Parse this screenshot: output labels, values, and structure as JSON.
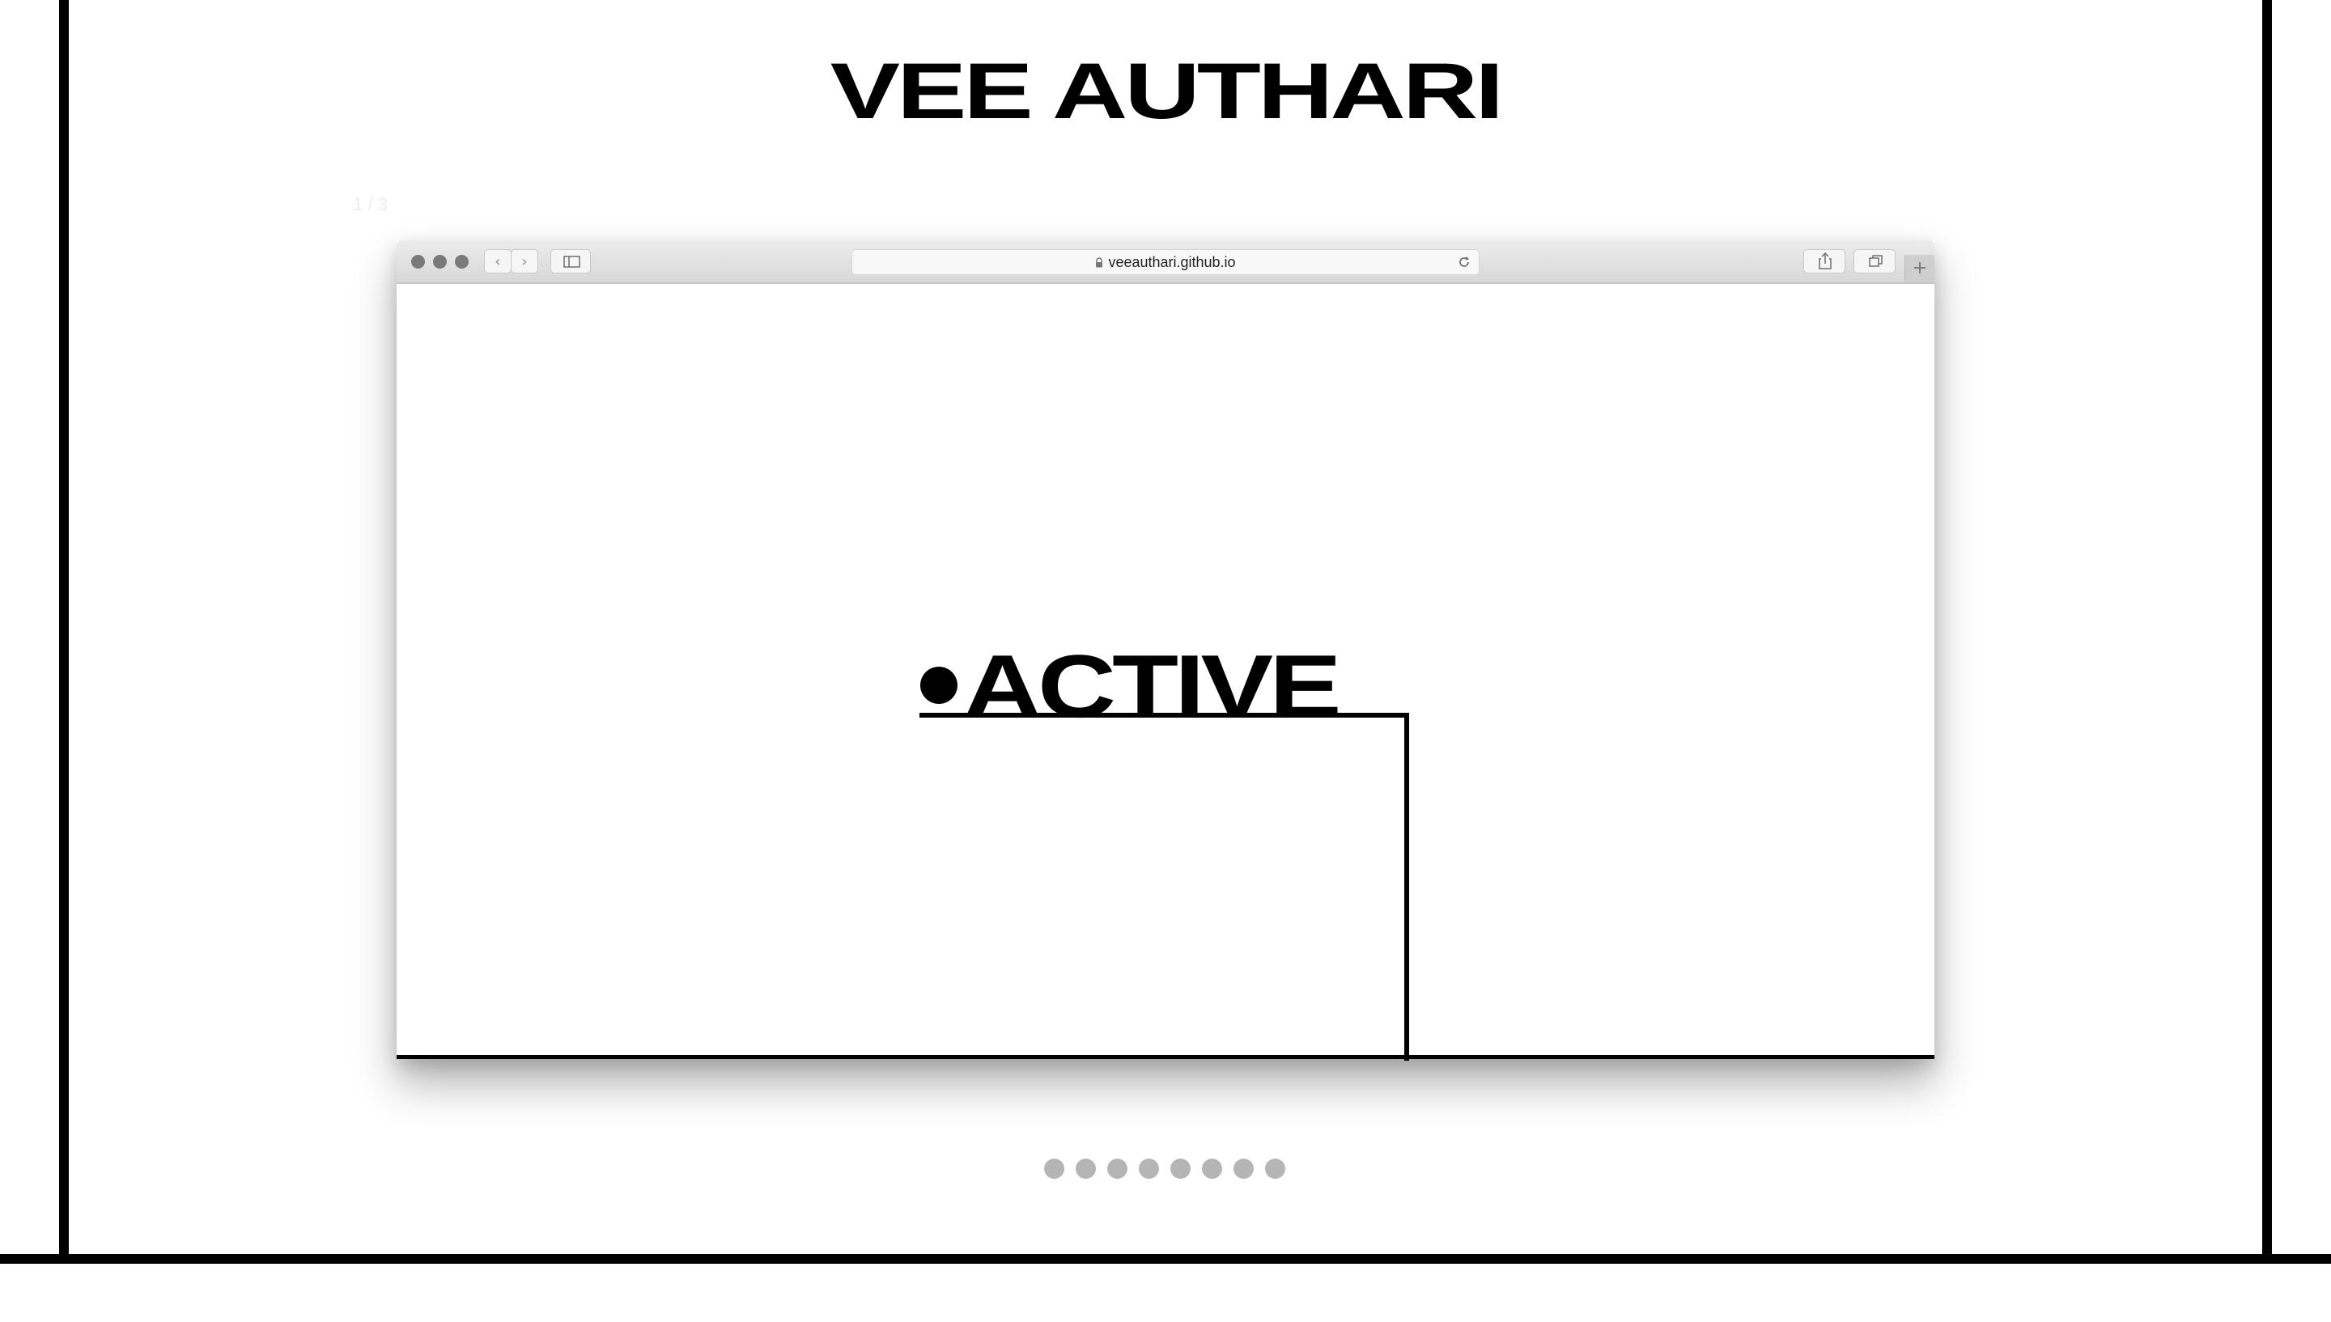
{
  "site": {
    "title": "VEE AUTHARI"
  },
  "slideshow": {
    "counter": "1 / 3",
    "dots": [
      1,
      2,
      3,
      4,
      5,
      6,
      7,
      8
    ]
  },
  "browser": {
    "address": "veeauthari.github.io",
    "window_controls": [
      "close-icon",
      "minimize-icon",
      "zoom-icon"
    ],
    "toolbar_icons": [
      "back-icon",
      "forward-icon",
      "sidebar-icon",
      "lock-icon",
      "reload-icon",
      "share-icon",
      "tabs-overview-icon",
      "new-tab-icon"
    ]
  },
  "page": {
    "headline": "ACTIVE"
  },
  "colors": {
    "frame": "#000000",
    "background": "#ffffff",
    "dot": "#b5b5b5",
    "toolbar": "#e2e2e2"
  }
}
